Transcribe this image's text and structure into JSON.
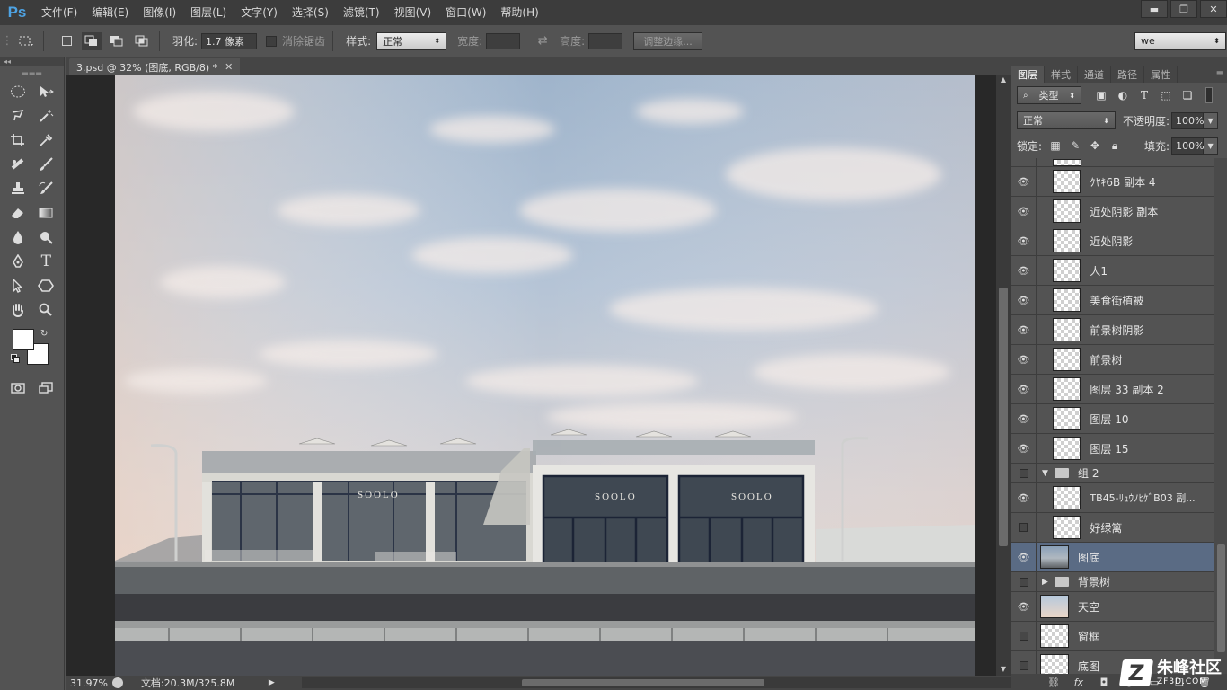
{
  "app": {
    "logo": "Ps"
  },
  "menu": [
    "文件(F)",
    "编辑(E)",
    "图像(I)",
    "图层(L)",
    "文字(Y)",
    "选择(S)",
    "滤镜(T)",
    "视图(V)",
    "窗口(W)",
    "帮助(H)"
  ],
  "window_controls": {
    "minimize": "▬",
    "restore": "❐",
    "close": "✕"
  },
  "options": {
    "feather_label": "羽化:",
    "feather_value": "1.7 像素",
    "antialias_label": "消除锯齿",
    "style_label": "样式:",
    "style_value": "正常",
    "width_label": "宽度:",
    "height_label": "高度:",
    "refine_edge": "调整边缘...",
    "workspace": "we"
  },
  "document": {
    "tab_title": "3.psd @ 32% (图底, RGB/8) *",
    "zoom": "31.97%",
    "doc_info": "文档:20.3M/325.8M",
    "storefront_sign": "SOOLO"
  },
  "panel_tabs": [
    "图层",
    "样式",
    "通道",
    "路径",
    "属性"
  ],
  "layers_panel": {
    "kind_filter": "类型",
    "blend_mode": "正常",
    "opacity_label": "不透明度:",
    "opacity_value": "100%",
    "lock_label": "锁定:",
    "fill_label": "填充:",
    "fill_value": "100%"
  },
  "layers": [
    {
      "name": "ｸﾔｷ6B 副本 4",
      "visible": true
    },
    {
      "name": "近处阴影 副本",
      "visible": true
    },
    {
      "name": "近处阴影",
      "visible": true
    },
    {
      "name": "人1",
      "visible": true
    },
    {
      "name": "美食街植被",
      "visible": true
    },
    {
      "name": "前景树阴影",
      "visible": true
    },
    {
      "name": "前景树",
      "visible": true
    },
    {
      "name": "图层 33 副本 2",
      "visible": true
    },
    {
      "name": "图层 10",
      "visible": true
    },
    {
      "name": "图层 15",
      "visible": true
    },
    {
      "name": "组 2",
      "visible": false,
      "group": true,
      "expanded": true
    },
    {
      "name": "TB45-ﾘｭｳﾉﾋｹﾞB03 副...",
      "visible": true
    },
    {
      "name": "好绿篱",
      "visible": false
    },
    {
      "name": "图底",
      "visible": true,
      "selected": true
    },
    {
      "name": "背景树",
      "visible": false,
      "group": true,
      "expanded": false
    },
    {
      "name": "天空",
      "visible": true
    },
    {
      "name": "窗框",
      "visible": false
    },
    {
      "name": "底图",
      "visible": false
    }
  ],
  "watermark": {
    "logo": "Z",
    "name": "朱峰社区",
    "url": "ZF3D.COM"
  }
}
